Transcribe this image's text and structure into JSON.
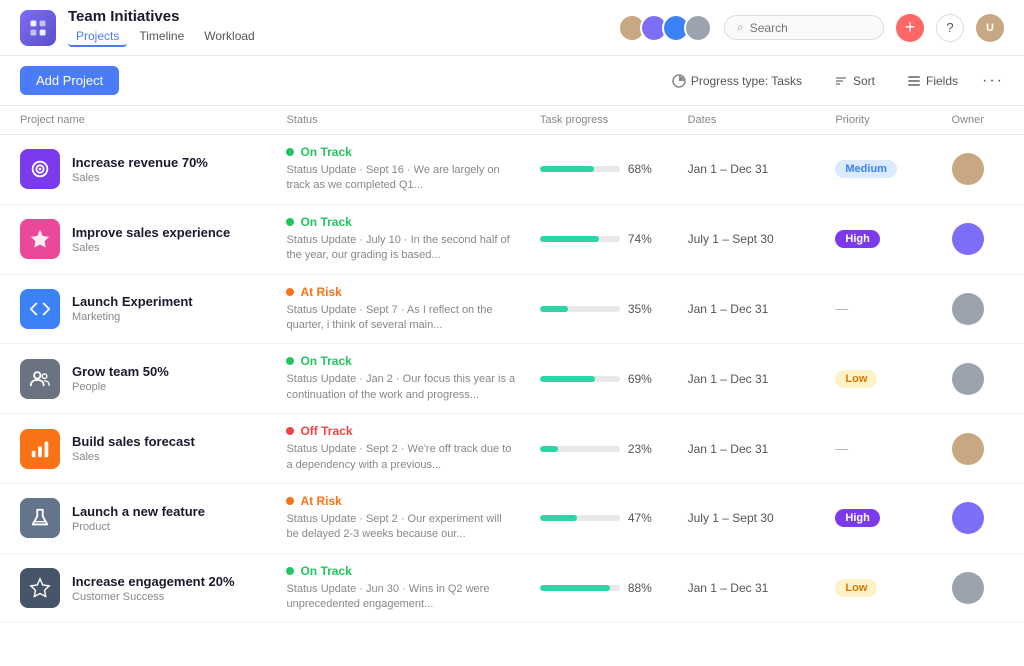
{
  "app": {
    "logo_alt": "Team Initiatives",
    "title": "Team Initiatives",
    "nav": [
      {
        "label": "Projects",
        "active": true
      },
      {
        "label": "Timeline",
        "active": false
      },
      {
        "label": "Workload",
        "active": false
      }
    ]
  },
  "toolbar": {
    "add_project_label": "Add Project",
    "progress_type_label": "Progress type: Tasks",
    "sort_label": "Sort",
    "fields_label": "Fields"
  },
  "table": {
    "headers": [
      "Project name",
      "Status",
      "Task progress",
      "Dates",
      "Priority",
      "Owner"
    ],
    "rows": [
      {
        "icon_color": "#7c3aed",
        "icon_type": "target",
        "name": "Increase revenue 70%",
        "team": "Sales",
        "status": "On Track",
        "status_color": "#22c55e",
        "status_update": "Status Update · Sept 16 · We are largely on track as we completed Q1...",
        "progress": 68,
        "dates": "Jan 1 – Dec 31",
        "priority": "Medium",
        "priority_class": "priority-medium",
        "owner_color": "#c8a882"
      },
      {
        "icon_color": "#ec4899",
        "icon_type": "star",
        "name": "Improve sales experience",
        "team": "Sales",
        "status": "On Track",
        "status_color": "#22c55e",
        "status_update": "Status Update · July 10 · In the second half of the year, our grading is based...",
        "progress": 74,
        "dates": "July 1 – Sept 30",
        "priority": "High",
        "priority_class": "priority-high",
        "owner_color": "#7c6ef7"
      },
      {
        "icon_color": "#3b82f6",
        "icon_type": "code",
        "name": "Launch Experiment",
        "team": "Marketing",
        "status": "At Risk",
        "status_color": "#f97316",
        "status_update": "Status Update · Sept 7 · As I reflect on the quarter, i think of several main...",
        "progress": 35,
        "dates": "Jan 1 – Dec 31",
        "priority": "—",
        "priority_class": "priority-none",
        "owner_color": "#9ca3af"
      },
      {
        "icon_color": "#6b7280",
        "icon_type": "people",
        "name": "Grow team 50%",
        "team": "People",
        "status": "On Track",
        "status_color": "#22c55e",
        "status_update": "Status Update · Jan 2 · Our focus this year is a continuation of the work and progress...",
        "progress": 69,
        "dates": "Jan 1 – Dec 31",
        "priority": "Low",
        "priority_class": "priority-low",
        "owner_color": "#9ca3af"
      },
      {
        "icon_color": "#f97316",
        "icon_type": "chart",
        "name": "Build sales forecast",
        "team": "Sales",
        "status": "Off Track",
        "status_color": "#ef4444",
        "status_update": "Status Update · Sept 2 · We're off track due to a dependency with a previous...",
        "progress": 23,
        "dates": "Jan 1 – Dec 31",
        "priority": "—",
        "priority_class": "priority-none",
        "owner_color": "#c8a882"
      },
      {
        "icon_color": "#64748b",
        "icon_type": "flask",
        "name": "Launch a new feature",
        "team": "Product",
        "status": "At Risk",
        "status_color": "#f97316",
        "status_update": "Status Update · Sept 2 · Our experiment will be delayed 2-3 weeks because our...",
        "progress": 47,
        "dates": "July 1 – Sept 30",
        "priority": "High",
        "priority_class": "priority-high",
        "owner_color": "#7c6ef7"
      },
      {
        "icon_color": "#475569",
        "icon_type": "star-outline",
        "name": "Increase engagement 20%",
        "team": "Customer Success",
        "status": "On Track",
        "status_color": "#22c55e",
        "status_update": "Status Update · Jun 30 · Wins in Q2 were unprecedented engagement...",
        "progress": 88,
        "dates": "Jan 1 – Dec 31",
        "priority": "Low",
        "priority_class": "priority-low",
        "owner_color": "#9ca3af"
      }
    ]
  },
  "search": {
    "placeholder": "Search"
  }
}
